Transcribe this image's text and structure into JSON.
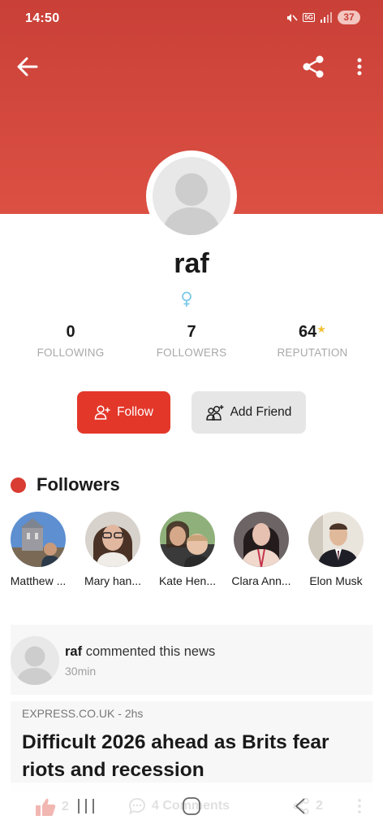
{
  "status_bar": {
    "time": "14:50",
    "network_badge": "5G",
    "battery": "37",
    "icons": [
      "mute-icon",
      "signal-icon",
      "battery-icon"
    ]
  },
  "top_bar": {
    "icons": [
      "back-arrow-icon",
      "share-icon",
      "more-vert-icon"
    ]
  },
  "profile": {
    "username": "raf",
    "gender_icon": "female-symbol-icon",
    "stats": [
      {
        "value": "0",
        "label": "FOLLOWING"
      },
      {
        "value": "7",
        "label": "FOLLOWERS"
      },
      {
        "value": "64",
        "label": "REPUTATION"
      }
    ]
  },
  "actions": {
    "follow_label": "Follow",
    "add_friend_label": "Add Friend"
  },
  "followers_section": {
    "title": "Followers",
    "items": [
      {
        "name": "Matthew ..."
      },
      {
        "name": "Mary han..."
      },
      {
        "name": "Kate Hen..."
      },
      {
        "name": "Clara Ann..."
      },
      {
        "name": "Elon Musk"
      }
    ]
  },
  "activity": {
    "user": "raf",
    "action": "commented this news",
    "time": "30min"
  },
  "news": {
    "source": "EXPRESS.CO.UK",
    "age": "- 2hs",
    "title": "Difficult 2026 ahead as Brits fear riots and recession"
  },
  "bottom_bar": {
    "likes": "2",
    "comments": "4 Comments",
    "shares": "2"
  },
  "colors": {
    "header_red": "#d2473d",
    "follow_button": "#e3372a",
    "section_dot": "#d83c32",
    "star": "#f3c235"
  }
}
